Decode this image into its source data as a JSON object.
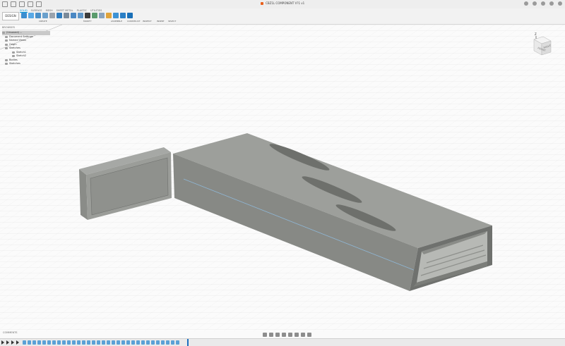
{
  "window": {
    "title": "CBZ1L  COMPONENT V?1 v1"
  },
  "toolbar": {
    "workspace": "DESIGN",
    "tabs": [
      "SOLID",
      "SURFACE",
      "MESH",
      "SHEET METAL",
      "PLASTIC",
      "UTILITIES"
    ],
    "active_tab": "SOLID",
    "groups": [
      "CREATE",
      "MODIFY",
      "ASSEMBLE",
      "CONSTRUCT",
      "INSPECT",
      "INSERT",
      "SELECT"
    ]
  },
  "browser": {
    "header": "BROWSER",
    "items": [
      {
        "label": "(Unsaved) ...",
        "selected": true
      },
      {
        "label": "Document Settings"
      },
      {
        "label": "Named Views"
      },
      {
        "label": "Origin"
      },
      {
        "label": "Sketches"
      },
      {
        "label": "Sketch1"
      },
      {
        "label": "Sketch2"
      },
      {
        "label": "Bodies"
      },
      {
        "label": "Sketches"
      }
    ]
  },
  "viewcube": {
    "top_label": "FRONT",
    "right_label": "RIGHT",
    "axis": "Z"
  },
  "bottom": {
    "comments": "COMMENTS"
  },
  "colors": {
    "accent": "#0696d7",
    "body_light": "#9b9d99",
    "body_dark": "#7c7e7b"
  }
}
